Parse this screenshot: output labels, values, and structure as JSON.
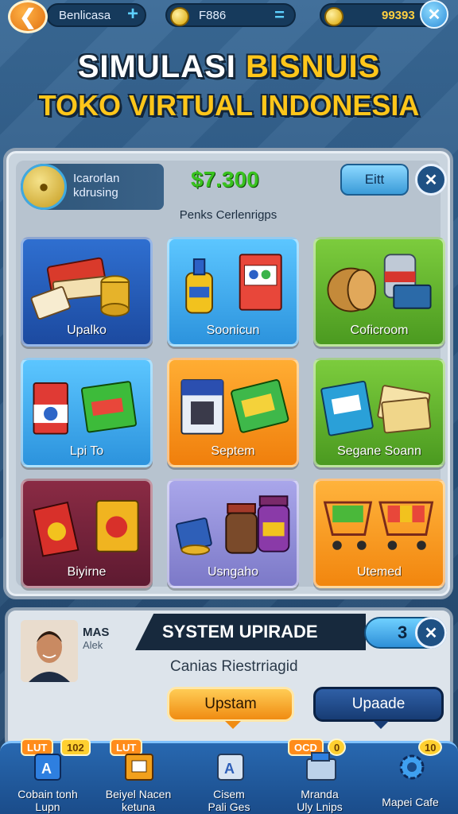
{
  "topbar": {
    "player_name": "Benlicasa",
    "coins_value": "F886",
    "gems_value": "99393"
  },
  "title": {
    "line1_white": "SIMULASI",
    "line1_gold": "BISNUIS",
    "line2": "TOKO VIRTUAL INDONESIA"
  },
  "store": {
    "label_line1": "Icarorlan",
    "label_line2": "kdrusing",
    "money": "$7.300",
    "edit_label": "Eitt",
    "subheading": "Penks Cerlenrigps"
  },
  "categories": [
    {
      "label": "Upalko"
    },
    {
      "label": "Soonicun"
    },
    {
      "label": "Coficroom"
    },
    {
      "label": "Lpi To"
    },
    {
      "label": "Septem"
    },
    {
      "label": "Segane Soann"
    },
    {
      "label": "Biyirne"
    },
    {
      "label": "Usngaho"
    },
    {
      "label": "Utemed"
    }
  ],
  "upgrade": {
    "avatar_name": "MAS",
    "avatar_sub": "Alek",
    "banner": "SYSTEM UPIRADE",
    "level": "3",
    "description": "Canias Riestrriagid",
    "btn_primary": "Upstam",
    "btn_secondary": "Upaade"
  },
  "nav": [
    {
      "line1": "Cobain tonh",
      "line2": "Lupn",
      "tag_left": "LUT",
      "tag_right": "102"
    },
    {
      "line1": "Beiyel Nacen",
      "line2": "ketuna",
      "tag_left": "LUT",
      "tag_right": ""
    },
    {
      "line1": "Cisem",
      "line2": "Pali Ges",
      "tag_left": "",
      "tag_right": ""
    },
    {
      "line1": "Mranda",
      "line2": "Uly Lnips",
      "tag_left": "OCD",
      "tag_right": "0"
    },
    {
      "line1": "Mapei Cafe",
      "line2": "",
      "tag_left": "",
      "tag_right": "10"
    }
  ],
  "colors": {
    "accent_gold": "#ffc61a",
    "money_green": "#39c21f",
    "nav_blue": "#2868b0"
  }
}
